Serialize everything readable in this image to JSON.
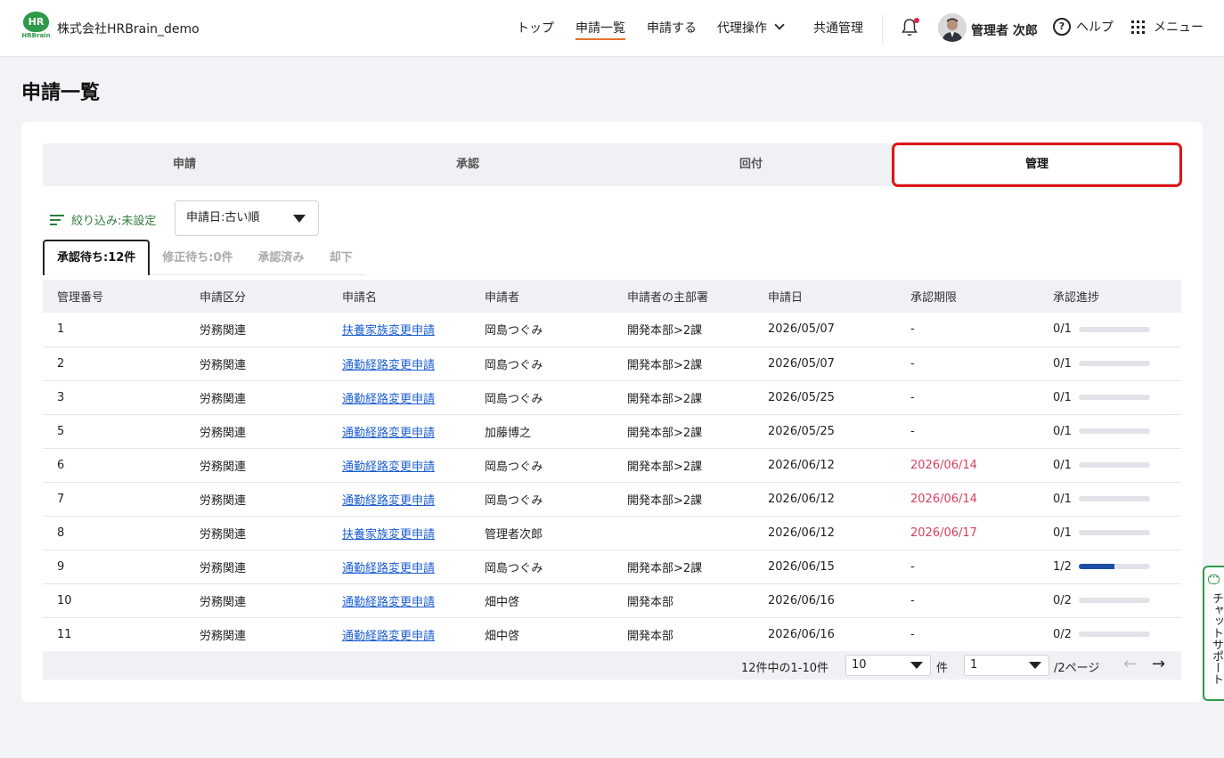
{
  "header": {
    "logo_text": "HR",
    "logo_brand": "HRBrain",
    "company": "株式会社HRBrain_demo",
    "nav": [
      {
        "label": "トップ"
      },
      {
        "label": "申請一覧"
      },
      {
        "label": "申請する"
      },
      {
        "label": "代理操作"
      },
      {
        "label": "共通管理"
      }
    ],
    "user_name": "管理者 次郎",
    "help_label": "ヘルプ",
    "menu_label": "メニュー"
  },
  "page": {
    "title": "申請一覧",
    "tabs": [
      "申請",
      "承認",
      "回付",
      "管理"
    ],
    "filter_label": "絞り込み:未設定",
    "sort_value": "申請日:古い順",
    "subtabs": [
      "承認待ち:12件",
      "修正待ち:0件",
      "承認済み",
      "却下"
    ]
  },
  "table": {
    "headers": [
      "管理番号",
      "申請区分",
      "申請名",
      "申請者",
      "申請者の主部署",
      "申請日",
      "承認期限",
      "承認進捗"
    ],
    "rows": [
      {
        "no": "1",
        "category": "労務関連",
        "name": "扶養家族変更申請",
        "applicant": "岡島つぐみ",
        "dept": "開発本部>2課",
        "date": "2026/05/07",
        "deadline": "-",
        "progress": "0/1",
        "fraction": 0,
        "overdue": false
      },
      {
        "no": "2",
        "category": "労務関連",
        "name": "通勤経路変更申請",
        "applicant": "岡島つぐみ",
        "dept": "開発本部>2課",
        "date": "2026/05/07",
        "deadline": "-",
        "progress": "0/1",
        "fraction": 0,
        "overdue": false
      },
      {
        "no": "3",
        "category": "労務関連",
        "name": "通勤経路変更申請",
        "applicant": "岡島つぐみ",
        "dept": "開発本部>2課",
        "date": "2026/05/25",
        "deadline": "-",
        "progress": "0/1",
        "fraction": 0,
        "overdue": false
      },
      {
        "no": "5",
        "category": "労務関連",
        "name": "通勤経路変更申請",
        "applicant": "加藤博之",
        "dept": "開発本部>2課",
        "date": "2026/05/25",
        "deadline": "-",
        "progress": "0/1",
        "fraction": 0,
        "overdue": false
      },
      {
        "no": "6",
        "category": "労務関連",
        "name": "通勤経路変更申請",
        "applicant": "岡島つぐみ",
        "dept": "開発本部>2課",
        "date": "2026/06/12",
        "deadline": "2026/06/14",
        "progress": "0/1",
        "fraction": 0,
        "overdue": true
      },
      {
        "no": "7",
        "category": "労務関連",
        "name": "通勤経路変更申請",
        "applicant": "岡島つぐみ",
        "dept": "開発本部>2課",
        "date": "2026/06/12",
        "deadline": "2026/06/14",
        "progress": "0/1",
        "fraction": 0,
        "overdue": true
      },
      {
        "no": "8",
        "category": "労務関連",
        "name": "扶養家族変更申請",
        "applicant": "管理者次郎",
        "dept": "",
        "date": "2026/06/12",
        "deadline": "2026/06/17",
        "progress": "0/1",
        "fraction": 0,
        "overdue": true
      },
      {
        "no": "9",
        "category": "労務関連",
        "name": "通勤経路変更申請",
        "applicant": "岡島つぐみ",
        "dept": "開発本部>2課",
        "date": "2026/06/15",
        "deadline": "-",
        "progress": "1/2",
        "fraction": 0.5,
        "overdue": false
      },
      {
        "no": "10",
        "category": "労務関連",
        "name": "通勤経路変更申請",
        "applicant": "畑中啓",
        "dept": "開発本部",
        "date": "2026/06/16",
        "deadline": "-",
        "progress": "0/2",
        "fraction": 0,
        "overdue": false
      },
      {
        "no": "11",
        "category": "労務関連",
        "name": "通勤経路変更申請",
        "applicant": "畑中啓",
        "dept": "開発本部",
        "date": "2026/06/16",
        "deadline": "-",
        "progress": "0/2",
        "fraction": 0,
        "overdue": false
      }
    ]
  },
  "pager": {
    "summary": "12件中の1-10件",
    "per_page": "10",
    "per_page_unit": "件",
    "page": "1",
    "page_suffix": "/2ページ"
  },
  "chat": {
    "label": "チャットサポート"
  },
  "colors": {
    "accent": "#2e9a4a",
    "link": "#1e5fd0",
    "overdue": "#d64060",
    "highlight": "#e01515"
  }
}
